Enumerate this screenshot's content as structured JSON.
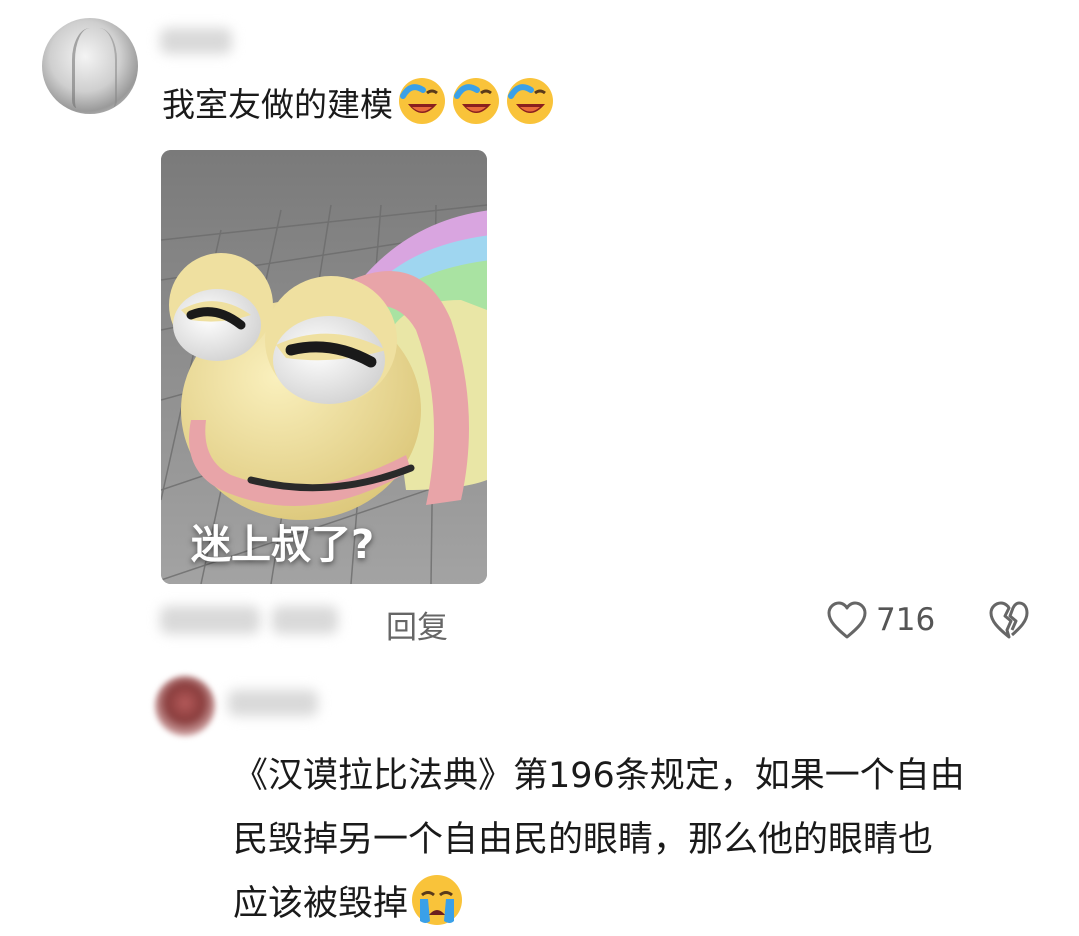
{
  "comment": {
    "text": "我室友做的建模",
    "emojis": [
      "laugh-cry-emoji",
      "laugh-cry-emoji",
      "laugh-cry-emoji"
    ],
    "image": {
      "caption": "迷上叔了?"
    },
    "reply_label": "回复",
    "like_count": "716"
  },
  "reply": {
    "lines": [
      "《汉谟拉比法典》第196条规定，如果一个自由",
      "民毁掉另一个自由民的眼睛，那么他的眼睛也",
      "应该被毁掉"
    ],
    "emoji": "crying-emoji"
  },
  "colors": {
    "background": "#ffffff",
    "meta_text": "#666666",
    "worm_head": "#efe0a0",
    "worm_band": "#e8a4a8"
  }
}
